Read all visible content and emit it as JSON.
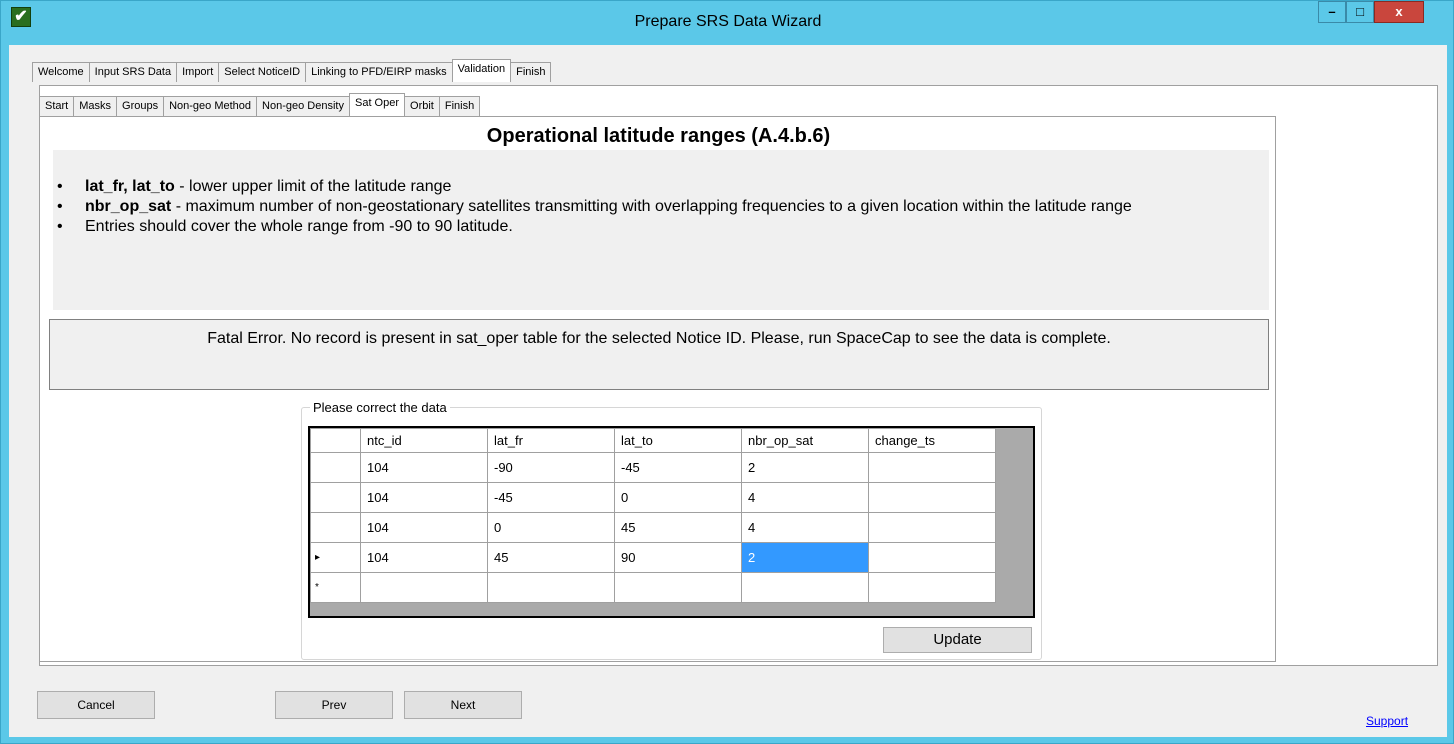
{
  "window": {
    "title": "Prepare SRS Data Wizard",
    "minimize_label": "–",
    "maximize_label": "□",
    "close_label": "x",
    "app_icon_glyph": "✔"
  },
  "main_tabs": [
    {
      "label": "Welcome"
    },
    {
      "label": "Input SRS Data"
    },
    {
      "label": "Import"
    },
    {
      "label": "Select NoticeID"
    },
    {
      "label": "Linking to PFD/EIRP masks"
    },
    {
      "label": "Validation",
      "active": true
    },
    {
      "label": "Finish"
    }
  ],
  "sub_tabs": [
    {
      "label": "Start"
    },
    {
      "label": "Masks"
    },
    {
      "label": "Groups"
    },
    {
      "label": "Non-geo Method"
    },
    {
      "label": "Non-geo Density"
    },
    {
      "label": "Sat Oper",
      "active": true
    },
    {
      "label": "Orbit"
    },
    {
      "label": "Finish"
    }
  ],
  "page": {
    "heading": "Operational latitude ranges (A.4.b.6)",
    "bullets": [
      {
        "term": "lat_fr, lat_to",
        "text": " - lower upper limit of the latitude range"
      },
      {
        "term": "nbr_op_sat",
        "text": " - maximum number of non-geostationary satellites transmitting with overlapping frequencies to a given location within the latitude range"
      },
      {
        "term": "",
        "text": "Entries should cover the whole range from -90 to 90 latitude."
      }
    ],
    "bullet_glyph": "•",
    "error_message": "Fatal Error. No record is present in sat_oper table for the selected Notice ID. Please, run SpaceCap to see the data is complete."
  },
  "grid": {
    "group_title": "Please correct the data",
    "columns": [
      "ntc_id",
      "lat_fr",
      "lat_to",
      "nbr_op_sat",
      "change_ts"
    ],
    "rows": [
      {
        "marker": "",
        "cells": [
          "104",
          "-90",
          "-45",
          "2",
          ""
        ]
      },
      {
        "marker": "",
        "cells": [
          "104",
          "-45",
          "0",
          "4",
          ""
        ]
      },
      {
        "marker": "",
        "cells": [
          "104",
          "0",
          "45",
          "4",
          ""
        ]
      },
      {
        "marker": "▸",
        "cells": [
          "104",
          "45",
          "90",
          "2",
          ""
        ],
        "selected_col": 3
      }
    ],
    "new_row_marker": "*",
    "update_label": "Update"
  },
  "footer": {
    "cancel_label": "Cancel",
    "prev_label": "Prev",
    "next_label": "Next",
    "support_label": "Support"
  },
  "colors": {
    "titlebar": "#5bc8e8",
    "selection": "#3399ff",
    "close_button": "#c9463d",
    "link": "#0000ff"
  }
}
